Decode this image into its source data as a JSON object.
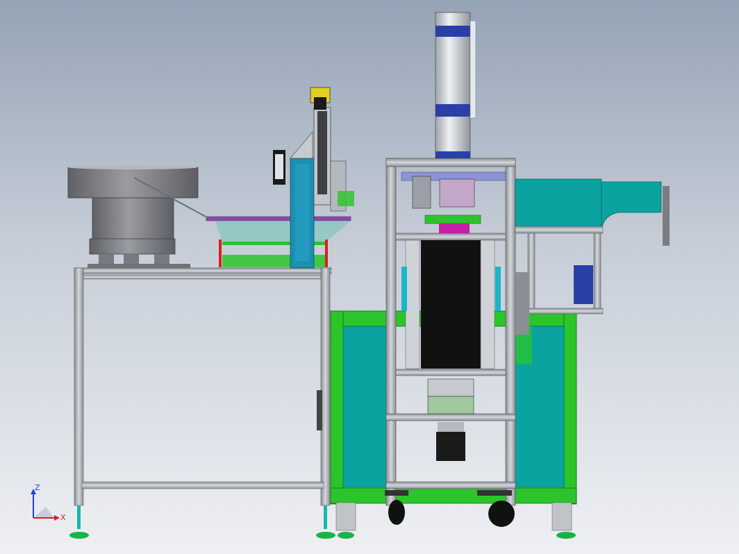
{
  "view": {
    "background_top": "#95a3b6",
    "background_bottom": "#eef0f3"
  },
  "colors": {
    "frame_green": "#2bc42b",
    "panel_teal": "#0aa3a0",
    "aluminum": "#a9adb3",
    "cylinder_silver": "#c9ced4",
    "bowl_gray": "#7b7d82",
    "motor_black": "#111111",
    "accent_blue": "#2b3fa8",
    "accent_purple": "#8a4aa8",
    "axis_x": "#d62020",
    "axis_z": "#1f3fd6"
  },
  "triad": {
    "x_label": "X",
    "z_label": "Z"
  }
}
